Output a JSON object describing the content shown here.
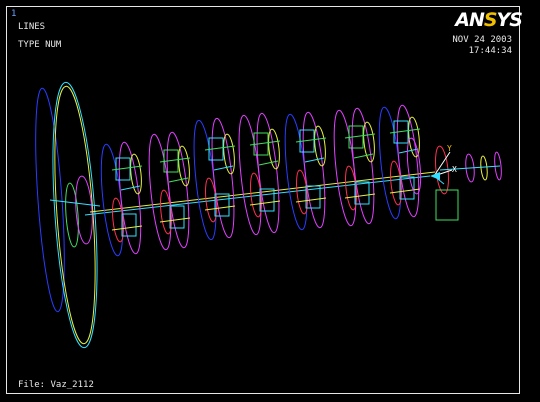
{
  "window": {
    "number": "1"
  },
  "legend": {
    "plot_type": "LINES",
    "numbering": "TYPE NUM",
    "date": "NOV 24 2003",
    "time": "17:44:34",
    "file": "File: Vaz_2112"
  },
  "logo": {
    "first": "AN",
    "accent": "S",
    "last": "YS"
  },
  "triad": {
    "x_label": "X",
    "y_label": "Y"
  },
  "colors": {
    "background": "#000000",
    "frame": "#e6e6e6",
    "blue": "#2a3cff",
    "cyan": "#33e0ff",
    "magenta": "#e040ff",
    "green": "#40e060",
    "yellow": "#e8f040",
    "red": "#ff3050",
    "white": "#ffffff"
  }
}
